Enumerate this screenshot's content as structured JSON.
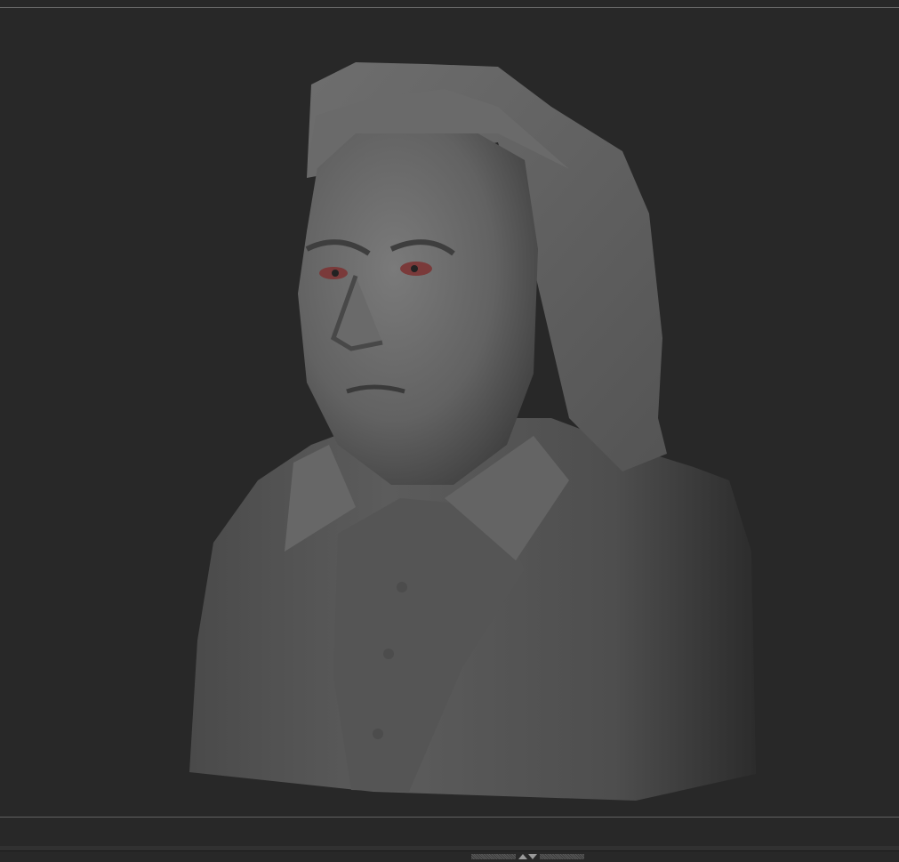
{
  "viewport": {
    "background_color": "#282828",
    "model": "sculpted-bust",
    "model_color": "#6e6e6e",
    "eye_color": "#7a3a3a"
  },
  "tray_handle": {
    "icon": "expand-collapse-arrows-icon"
  }
}
